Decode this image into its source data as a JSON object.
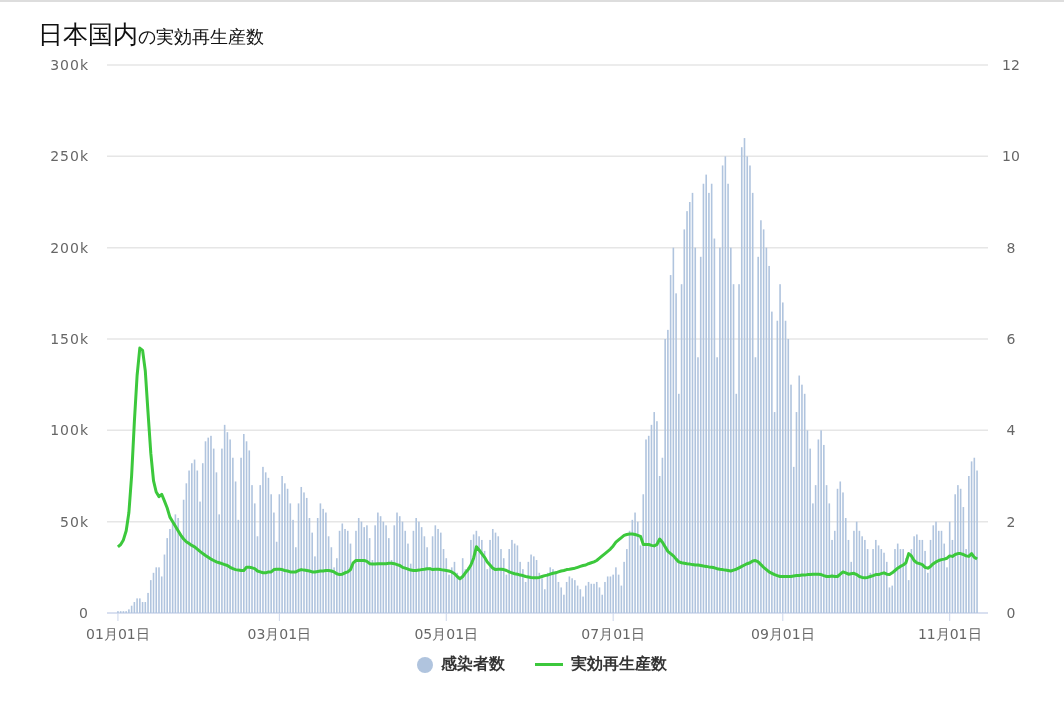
{
  "title": {
    "main": "日本国内",
    "sub": "の実効再生産数"
  },
  "chart_data": {
    "type": "bar",
    "grid": true,
    "ylim": [
      0,
      300
    ],
    "y2lim": [
      0,
      12
    ],
    "yticks": [
      {
        "value": 0,
        "label": "0"
      },
      {
        "value": 50,
        "label": "50k"
      },
      {
        "value": 100,
        "label": "100k"
      },
      {
        "value": 150,
        "label": "150k"
      },
      {
        "value": 200,
        "label": "200k"
      },
      {
        "value": 250,
        "label": "250k"
      },
      {
        "value": 300,
        "label": "300k"
      }
    ],
    "y2ticks": [
      0,
      2,
      4,
      6,
      8,
      10,
      12
    ],
    "categories": [
      "01月01日",
      null,
      null,
      null,
      null,
      null,
      null,
      null,
      null,
      null,
      null,
      null,
      null,
      null,
      null,
      null,
      null,
      null,
      null,
      null,
      null,
      null,
      null,
      null,
      null,
      null,
      null,
      null,
      null,
      null,
      null,
      null,
      null,
      null,
      null,
      null,
      null,
      null,
      null,
      null,
      null,
      null,
      null,
      null,
      null,
      null,
      null,
      null,
      null,
      null,
      null,
      null,
      null,
      null,
      null,
      null,
      null,
      null,
      null,
      "03月01日",
      null,
      null,
      null,
      null,
      null,
      null,
      null,
      null,
      null,
      null,
      null,
      null,
      null,
      null,
      null,
      null,
      null,
      null,
      null,
      null,
      null,
      null,
      null,
      null,
      null,
      null,
      null,
      null,
      null,
      null,
      null,
      null,
      null,
      null,
      null,
      null,
      null,
      null,
      null,
      null,
      null,
      null,
      null,
      null,
      null,
      null,
      null,
      null,
      null,
      null,
      null,
      null,
      null,
      null,
      null,
      null,
      null,
      null,
      null,
      null,
      "05月01日",
      null,
      null,
      null,
      null,
      null,
      null,
      null,
      null,
      null,
      null,
      null,
      null,
      null,
      null,
      null,
      null,
      null,
      null,
      null,
      null,
      null,
      null,
      null,
      null,
      null,
      null,
      null,
      null,
      null,
      null,
      null,
      null,
      null,
      null,
      null,
      null,
      null,
      null,
      null,
      null,
      null,
      null,
      null,
      null,
      null,
      null,
      null,
      null,
      null,
      null,
      null,
      null,
      null,
      null,
      null,
      null,
      null,
      null,
      null,
      null,
      "07月01日",
      null,
      null,
      null,
      null,
      null,
      null,
      null,
      null,
      null,
      null,
      null,
      null,
      null,
      null,
      null,
      null,
      null,
      null,
      null,
      null,
      null,
      null,
      null,
      null,
      null,
      null,
      null,
      null,
      null,
      null,
      null,
      null,
      null,
      null,
      null,
      null,
      null,
      null,
      null,
      null,
      null,
      null,
      null,
      null,
      null,
      null,
      null,
      null,
      null,
      null,
      null,
      null,
      null,
      null,
      null,
      null,
      null,
      null,
      null,
      null,
      null,
      "09月01日",
      null,
      null,
      null,
      null,
      null,
      null,
      null,
      null,
      null,
      null,
      null,
      null,
      null,
      null,
      null,
      null,
      null,
      null,
      null,
      null,
      null,
      null,
      null,
      null,
      null,
      null,
      null,
      null,
      null,
      null,
      null,
      null,
      null,
      null,
      null,
      null,
      null,
      null,
      null,
      null,
      null,
      null,
      null,
      null,
      null,
      null,
      null,
      null,
      null,
      null,
      null,
      null,
      null,
      null,
      null,
      null,
      null,
      null,
      null,
      null,
      "11月01日",
      null,
      null,
      null,
      null,
      null,
      null,
      null,
      null,
      null,
      null
    ],
    "series": [
      {
        "name": "感染者数",
        "color": "#b0c4de",
        "values": [
          1,
          1,
          1,
          1,
          2,
          4,
          6,
          8,
          8,
          6,
          6,
          11,
          18,
          22,
          25,
          25,
          20,
          32,
          41,
          46,
          50,
          54,
          52,
          42,
          62,
          71,
          78,
          82,
          84,
          78,
          61,
          82,
          94,
          96,
          97,
          90,
          77,
          54,
          90,
          103,
          99,
          95,
          85,
          72,
          51,
          85,
          98,
          94,
          89,
          70,
          60,
          42,
          70,
          80,
          77,
          74,
          65,
          55,
          39,
          65,
          75,
          71,
          68,
          60,
          51,
          36,
          60,
          69,
          66,
          63,
          52,
          44,
          31,
          52,
          60,
          57,
          55,
          42,
          36,
          25,
          30,
          45,
          49,
          46,
          45,
          38,
          27,
          45,
          52,
          50,
          47,
          48,
          41,
          29,
          48,
          55,
          53,
          50,
          48,
          41,
          29,
          48,
          55,
          53,
          50,
          45,
          38,
          27,
          45,
          52,
          50,
          47,
          42,
          36,
          25,
          42,
          48,
          46,
          44,
          35,
          30,
          21,
          25,
          28,
          22,
          20,
          30,
          24,
          25,
          40,
          43,
          45,
          42,
          40,
          34,
          24,
          40,
          46,
          44,
          42,
          35,
          30,
          21,
          35,
          40,
          38,
          37,
          28,
          24,
          17,
          28,
          32,
          31,
          29,
          22,
          19,
          13,
          22,
          25,
          24,
          23,
          17,
          14,
          10,
          17,
          20,
          19,
          18,
          15,
          13,
          9,
          15,
          17,
          16,
          16,
          17,
          14,
          10,
          17,
          20,
          20,
          21,
          25,
          21,
          15,
          28,
          35,
          45,
          51,
          55,
          50,
          37,
          65,
          95,
          97,
          103,
          110,
          105,
          75,
          85,
          150,
          155,
          185,
          200,
          175,
          120,
          180,
          210,
          220,
          225,
          230,
          200,
          140,
          195,
          235,
          240,
          230,
          235,
          205,
          140,
          200,
          245,
          250,
          235,
          200,
          180,
          120,
          180,
          255,
          260,
          250,
          245,
          230,
          140,
          195,
          215,
          210,
          200,
          190,
          165,
          110,
          160,
          180,
          170,
          160,
          150,
          125,
          80,
          110,
          130,
          125,
          120,
          100,
          90,
          60,
          70,
          95,
          100,
          92,
          70,
          60,
          40,
          45,
          68,
          72,
          66,
          52,
          40,
          28,
          45,
          50,
          45,
          42,
          40,
          35,
          22,
          35,
          40,
          37,
          35,
          33,
          28,
          14,
          15,
          35,
          38,
          35,
          35,
          30,
          18,
          35,
          42,
          43,
          40,
          40,
          34,
          22,
          40,
          48,
          50,
          45,
          45,
          38,
          25,
          50,
          40,
          65,
          70,
          68,
          58,
          35,
          75,
          83,
          85,
          78
        ]
      },
      {
        "name": "実効再生産数",
        "color": "#3cc83c",
        "axis": "y2",
        "type": "line",
        "values": [
          1.45,
          1.5,
          1.6,
          1.8,
          2.2,
          3.0,
          4.2,
          5.2,
          5.8,
          5.75,
          5.3,
          4.4,
          3.5,
          2.9,
          2.65,
          2.55,
          2.6,
          2.45,
          2.3,
          2.1,
          2.0,
          1.9,
          1.8,
          1.7,
          1.62,
          1.56,
          1.52,
          1.48,
          1.45,
          1.4,
          1.35,
          1.3,
          1.26,
          1.22,
          1.18,
          1.15,
          1.12,
          1.1,
          1.08,
          1.06,
          1.04,
          1.0,
          0.97,
          0.95,
          0.94,
          0.93,
          0.93,
          1.0,
          1.0,
          0.99,
          0.97,
          0.92,
          0.9,
          0.88,
          0.88,
          0.9,
          0.9,
          0.95,
          0.96,
          0.96,
          0.95,
          0.93,
          0.92,
          0.9,
          0.9,
          0.9,
          0.93,
          0.95,
          0.94,
          0.93,
          0.92,
          0.9,
          0.9,
          0.91,
          0.92,
          0.92,
          0.93,
          0.93,
          0.92,
          0.9,
          0.86,
          0.84,
          0.85,
          0.88,
          0.9,
          0.95,
          1.1,
          1.15,
          1.15,
          1.15,
          1.15,
          1.13,
          1.08,
          1.07,
          1.07,
          1.08,
          1.08,
          1.08,
          1.08,
          1.09,
          1.09,
          1.08,
          1.06,
          1.04,
          1.0,
          0.98,
          0.96,
          0.94,
          0.93,
          0.93,
          0.94,
          0.95,
          0.96,
          0.97,
          0.97,
          0.95,
          0.96,
          0.96,
          0.95,
          0.94,
          0.93,
          0.92,
          0.9,
          0.86,
          0.8,
          0.75,
          0.8,
          0.88,
          0.95,
          1.05,
          1.2,
          1.45,
          1.38,
          1.3,
          1.22,
          1.12,
          1.05,
          0.98,
          0.95,
          0.96,
          0.96,
          0.95,
          0.93,
          0.9,
          0.88,
          0.86,
          0.85,
          0.83,
          0.82,
          0.8,
          0.79,
          0.78,
          0.77,
          0.77,
          0.78,
          0.8,
          0.82,
          0.83,
          0.85,
          0.87,
          0.88,
          0.9,
          0.92,
          0.93,
          0.95,
          0.96,
          0.97,
          0.98,
          1.0,
          1.02,
          1.04,
          1.05,
          1.08,
          1.1,
          1.12,
          1.15,
          1.2,
          1.25,
          1.3,
          1.35,
          1.4,
          1.47,
          1.55,
          1.6,
          1.65,
          1.7,
          1.72,
          1.73,
          1.73,
          1.72,
          1.7,
          1.68,
          1.5,
          1.5,
          1.5,
          1.48,
          1.47,
          1.5,
          1.62,
          1.55,
          1.45,
          1.35,
          1.3,
          1.25,
          1.18,
          1.12,
          1.1,
          1.09,
          1.08,
          1.07,
          1.06,
          1.05,
          1.05,
          1.04,
          1.03,
          1.02,
          1.01,
          1.0,
          0.99,
          0.97,
          0.96,
          0.95,
          0.94,
          0.93,
          0.92,
          0.94,
          0.96,
          0.99,
          1.02,
          1.05,
          1.08,
          1.1,
          1.14,
          1.15,
          1.12,
          1.06,
          1.0,
          0.95,
          0.9,
          0.87,
          0.84,
          0.82,
          0.8,
          0.8,
          0.8,
          0.8,
          0.8,
          0.81,
          0.82,
          0.82,
          0.83,
          0.83,
          0.84,
          0.84,
          0.85,
          0.85,
          0.85,
          0.84,
          0.82,
          0.8,
          0.8,
          0.81,
          0.8,
          0.8,
          0.85,
          0.9,
          0.88,
          0.85,
          0.86,
          0.87,
          0.84,
          0.8,
          0.78,
          0.77,
          0.78,
          0.8,
          0.82,
          0.84,
          0.84,
          0.86,
          0.88,
          0.85,
          0.84,
          0.88,
          0.93,
          0.98,
          1.02,
          1.05,
          1.1,
          1.3,
          1.25,
          1.15,
          1.1,
          1.08,
          1.06,
          1.0,
          0.98,
          1.02,
          1.08,
          1.12,
          1.15,
          1.17,
          1.18,
          1.2,
          1.25,
          1.24,
          1.28,
          1.3,
          1.3,
          1.28,
          1.25,
          1.24,
          1.3,
          1.22,
          1.18
        ]
      }
    ]
  }
}
